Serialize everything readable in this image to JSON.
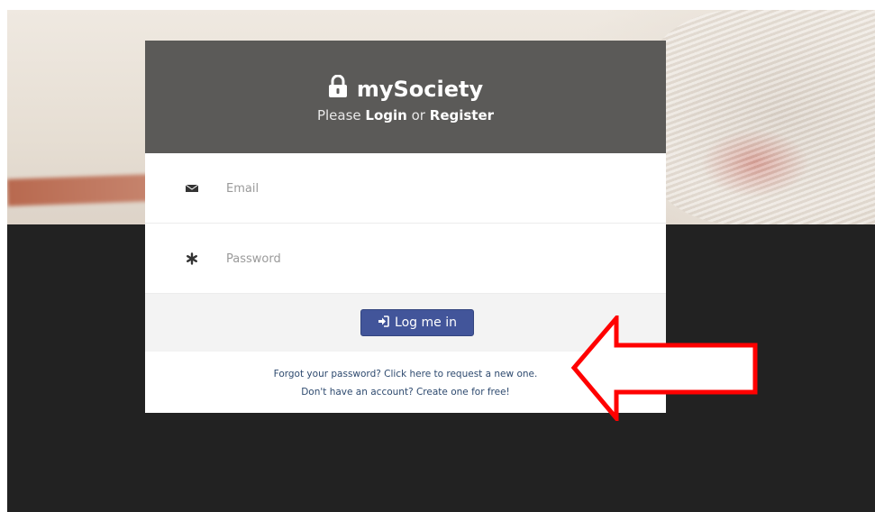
{
  "brand": {
    "name": "mySociety",
    "icon": "lock-icon"
  },
  "header": {
    "subtitle_prefix": "Please",
    "login_label": "Login",
    "subtitle_or": "or",
    "register_label": "Register"
  },
  "form": {
    "email": {
      "placeholder": "Email",
      "icon": "envelope-icon"
    },
    "password": {
      "placeholder": "Password",
      "icon": "asterisk-icon"
    },
    "submit": {
      "label": "Log me in",
      "icon": "sign-in-icon"
    }
  },
  "links": {
    "forgot": "Forgot your password? Click here to request a new one.",
    "create": "Don't have an account? Create one for free!"
  },
  "annotation": {
    "arrow_color": "#ff0000",
    "arrow_direction": "left"
  },
  "colors": {
    "header_bg": "#5b5a58",
    "button_bg": "#42559a",
    "dark_bg": "#222222",
    "link": "#2e4a6f"
  }
}
